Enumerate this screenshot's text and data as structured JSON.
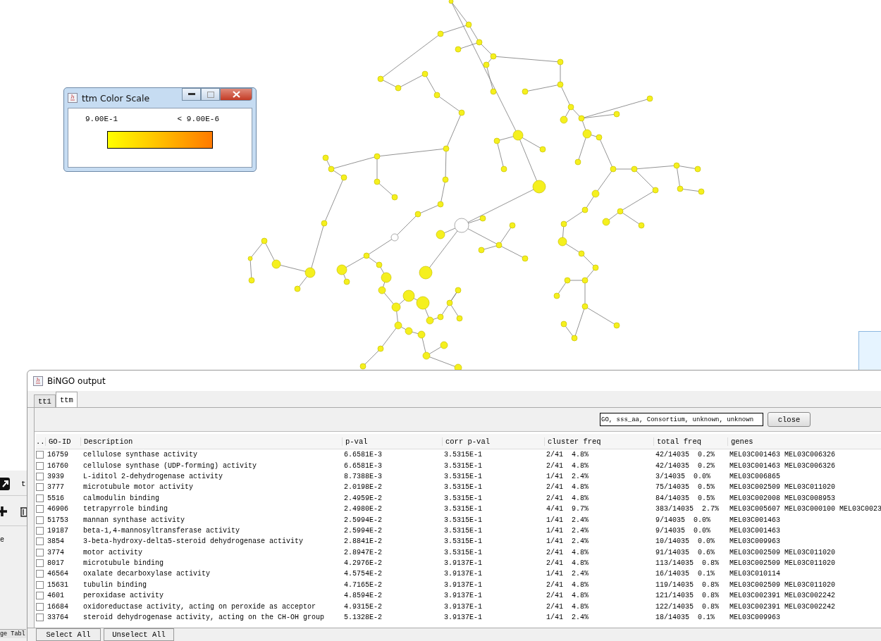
{
  "color_scale_window": {
    "title": "ttm Color Scale",
    "min_label": "9.00E-1",
    "max_label": "< 9.00E-6"
  },
  "side_panel": {
    "tab_label": "t",
    "item_label": "e",
    "table_tab": "ge Tabl"
  },
  "bingo_window": {
    "title": "BiNGO output",
    "tabs": [
      {
        "label": "tt1",
        "selected": false
      },
      {
        "label": "ttm",
        "selected": true
      }
    ],
    "ontology_field": {
      "value": "GO, sss_aa, Consortium, unknown, unknown"
    },
    "close_button": "close",
    "table": {
      "checkbox_header": "..",
      "columns": [
        "GO-ID",
        "Description",
        "p-val",
        "corr p-val",
        "cluster freq",
        "total freq",
        "genes"
      ],
      "rows": [
        {
          "checked": false,
          "cells": [
            "16759",
            "cellulose synthase activity",
            "6.6581E-3",
            "3.5315E-1",
            "2/41  4.8%",
            "42/14035  0.2%",
            "MEL03C001463 MEL03C006326"
          ]
        },
        {
          "checked": false,
          "cells": [
            "16760",
            "cellulose synthase (UDP-forming) activity",
            "6.6581E-3",
            "3.5315E-1",
            "2/41  4.8%",
            "42/14035  0.2%",
            "MEL03C001463 MEL03C006326"
          ]
        },
        {
          "checked": false,
          "cells": [
            "3939",
            "L-iditol 2-dehydrogenase activity",
            "8.7388E-3",
            "3.5315E-1",
            "1/41  2.4%",
            "3/14035  0.0%",
            "MEL03C006865"
          ]
        },
        {
          "checked": false,
          "cells": [
            "3777",
            "microtubule motor activity",
            "2.0198E-2",
            "3.5315E-1",
            "2/41  4.8%",
            "75/14035  0.5%",
            "MEL03C002509 MEL03C011020"
          ]
        },
        {
          "checked": false,
          "cells": [
            "5516",
            "calmodulin binding",
            "2.4959E-2",
            "3.5315E-1",
            "2/41  4.8%",
            "84/14035  0.5%",
            "MEL03C002008 MEL03C008953"
          ]
        },
        {
          "checked": false,
          "cells": [
            "46906",
            "tetrapyrrole binding",
            "2.4980E-2",
            "3.5315E-1",
            "4/41  9.7%",
            "383/14035  2.7%",
            "MEL03C005607 MEL03C000100 MEL03C0023"
          ]
        },
        {
          "checked": false,
          "cells": [
            "51753",
            "mannan synthase activity",
            "2.5994E-2",
            "3.5315E-1",
            "1/41  2.4%",
            "9/14035  0.0%",
            "MEL03C001463"
          ]
        },
        {
          "checked": false,
          "cells": [
            "19187",
            "beta-1,4-mannosyltransferase activity",
            "2.5994E-2",
            "3.5315E-1",
            "1/41  2.4%",
            "9/14035  0.0%",
            "MEL03C001463"
          ]
        },
        {
          "checked": false,
          "cells": [
            "3854",
            "3-beta-hydroxy-delta5-steroid dehydrogenase activity",
            "2.8841E-2",
            "3.5315E-1",
            "1/41  2.4%",
            "10/14035  0.0%",
            "MEL03C009963"
          ]
        },
        {
          "checked": false,
          "cells": [
            "3774",
            "motor activity",
            "2.8947E-2",
            "3.5315E-1",
            "2/41  4.8%",
            "91/14035  0.6%",
            "MEL03C002509 MEL03C011020"
          ]
        },
        {
          "checked": false,
          "cells": [
            "8017",
            "microtubule binding",
            "4.2976E-2",
            "3.9137E-1",
            "2/41  4.8%",
            "113/14035  0.8%",
            "MEL03C002509 MEL03C011020"
          ]
        },
        {
          "checked": false,
          "cells": [
            "46564",
            "oxalate decarboxylase activity",
            "4.5754E-2",
            "3.9137E-1",
            "1/41  2.4%",
            "16/14035  0.1%",
            "MEL03C010114"
          ]
        },
        {
          "checked": false,
          "cells": [
            "15631",
            "tubulin binding",
            "4.7165E-2",
            "3.9137E-1",
            "2/41  4.8%",
            "119/14035  0.8%",
            "MEL03C002509 MEL03C011020"
          ]
        },
        {
          "checked": false,
          "cells": [
            "4601",
            "peroxidase activity",
            "4.8594E-2",
            "3.9137E-1",
            "2/41  4.8%",
            "121/14035  0.8%",
            "MEL03C002391 MEL03C002242"
          ]
        },
        {
          "checked": false,
          "cells": [
            "16684",
            "oxidoreductase activity, acting on peroxide as acceptor",
            "4.9315E-2",
            "3.9137E-1",
            "2/41  4.8%",
            "122/14035  0.8%",
            "MEL03C002391 MEL03C002242"
          ]
        },
        {
          "checked": false,
          "cells": [
            "33764",
            "steroid dehydrogenase activity, acting on the CH-OH group",
            "5.1328E-2",
            "3.9137E-1",
            "1/41  2.4%",
            "18/14035  0.1%",
            "MEL03C009963"
          ]
        }
      ]
    },
    "buttons": [
      "Select All",
      "Unselect All"
    ]
  }
}
